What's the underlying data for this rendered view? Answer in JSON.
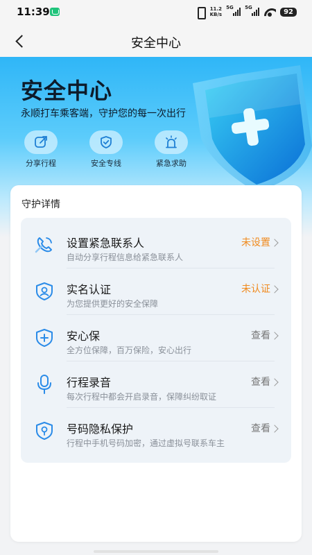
{
  "status_bar": {
    "time": "11:39",
    "net_speed_value": "11.2",
    "net_speed_unit": "KB/s",
    "sim1": "5G",
    "sim2": "5G",
    "battery": "92"
  },
  "nav": {
    "title": "安全中心",
    "back_icon": "chevron-left-icon"
  },
  "hero": {
    "title": "安全中心",
    "subtitle": "永顺打车乘客端，守护您的每一次出行",
    "quick_actions": [
      {
        "label": "分享行程",
        "icon": "share-icon"
      },
      {
        "label": "安全专线",
        "icon": "shield-check-icon"
      },
      {
        "label": "紧急求助",
        "icon": "alarm-icon"
      }
    ]
  },
  "details": {
    "title": "守护详情",
    "items": [
      {
        "title": "设置紧急联系人",
        "desc": "自动分享行程信息给紧急联系人",
        "status": "未设置",
        "icon": "phone-icon"
      },
      {
        "title": "实名认证",
        "desc": "为您提供更好的安全保障",
        "status": "未认证",
        "icon": "id-shield-icon"
      },
      {
        "title": "安心保",
        "desc": "全方位保障，百万保险，安心出行",
        "status": "查看",
        "icon": "plus-shield-icon"
      },
      {
        "title": "行程录音",
        "desc": "每次行程中都会开启录音，保障纠纷取证",
        "status": "查看",
        "icon": "microphone-icon"
      },
      {
        "title": "号码隐私保护",
        "desc": "行程中手机号码加密，通过虚拟号联系车主",
        "status": "查看",
        "icon": "lock-shield-icon"
      }
    ]
  },
  "colors": {
    "accent": "#2fb6f7",
    "warning": "#f08a1e",
    "icon_blue": "#2a8be8"
  }
}
